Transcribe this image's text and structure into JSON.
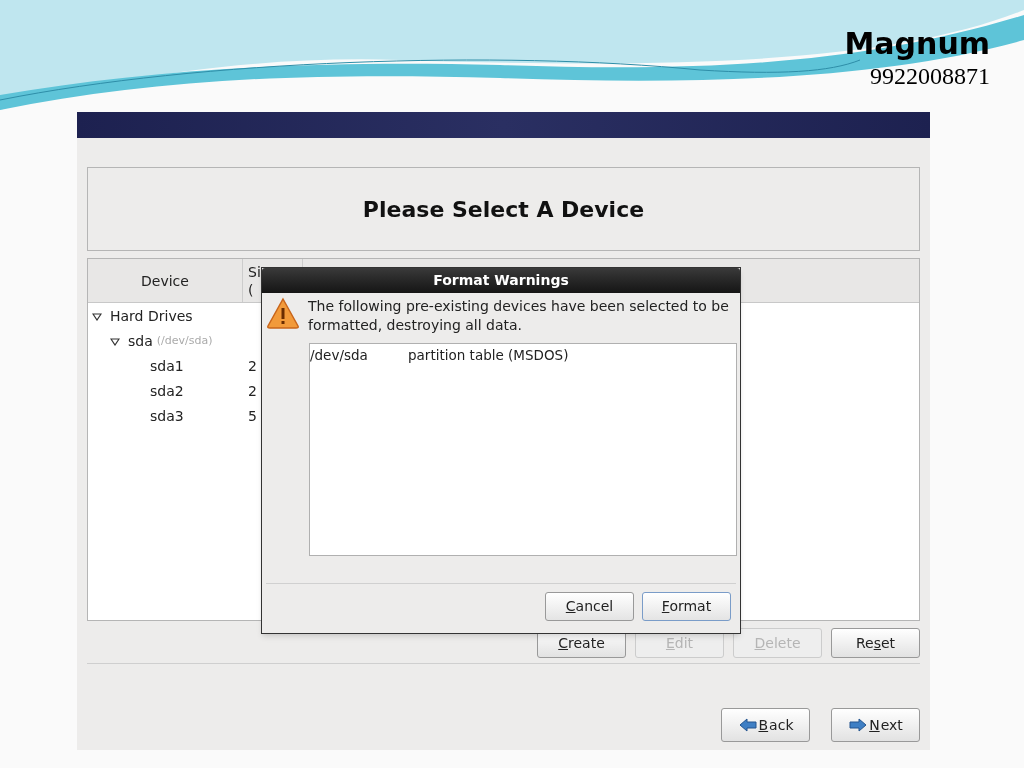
{
  "slide": {
    "title": "Magnum",
    "subtitle": "9922008871"
  },
  "installer": {
    "heading": "Please Select A Device",
    "columns": [
      {
        "lines": [
          "Device"
        ]
      },
      {
        "lines": [
          "Si",
          "("
        ]
      }
    ],
    "tree": [
      {
        "label": "Hard Drives",
        "expanded": true,
        "children": [
          {
            "label": "sda",
            "path": "(/dev/sda)",
            "expanded": true,
            "children": [
              {
                "label": "sda1",
                "size": "2"
              },
              {
                "label": "sda2",
                "size": "2"
              },
              {
                "label": "sda3",
                "size": "5"
              }
            ]
          }
        ]
      }
    ],
    "buttons": [
      {
        "key": "C",
        "post": "reate",
        "disabled": false
      },
      {
        "key": "E",
        "post": "dit",
        "disabled": true
      },
      {
        "key": "D",
        "post": "elete",
        "disabled": true
      },
      {
        "pre": "Re",
        "key": "s",
        "post": "et",
        "disabled": false
      }
    ],
    "nav": [
      {
        "kind": "back",
        "key": "B",
        "post": "ack"
      },
      {
        "kind": "next",
        "key": "N",
        "post": "ext"
      }
    ]
  },
  "dialog": {
    "title": "Format Warnings",
    "message": "The following pre-existing devices have been selected to be formatted, destroying all data.",
    "items": [
      {
        "device": "/dev/sda",
        "description": "partition table (MSDOS)"
      }
    ],
    "buttons": [
      {
        "key": "C",
        "post": "ancel",
        "focused": false
      },
      {
        "key": "F",
        "post": "ormat",
        "focused": true
      }
    ]
  }
}
